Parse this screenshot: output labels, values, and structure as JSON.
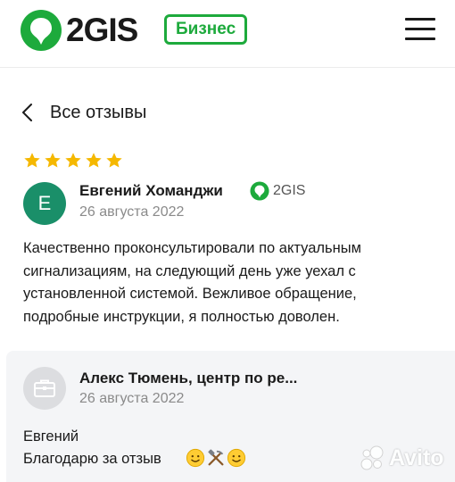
{
  "header": {
    "logo_text": "2GIS",
    "badge_label": "Бизнес",
    "brand_color": "#1daa3c",
    "menu_icon": "hamburger-menu-icon"
  },
  "nav": {
    "back_label": "Все отзывы",
    "back_icon": "chevron-left-icon"
  },
  "review": {
    "rating": 5,
    "rating_max": 5,
    "avatar_letter": "Е",
    "avatar_color": "#1a8f69",
    "author": "Евгений Хоманджи",
    "source_label": "2GIS",
    "date": "26 августа 2022",
    "text": "Качественно проконсультировали по актуальным сигнализациям, на следующий день уже уехал с установленной системой. Вежливое обращение, подробные инструкции, я полностью доволен."
  },
  "reply": {
    "avatar_icon": "briefcase-icon",
    "author": "Алекс Тюмень, центр по ре...",
    "date": "26 августа 2022",
    "line1": "Евгений",
    "line2": "Благодарю за отзыв",
    "emojis": [
      "slightly-smiling-face",
      "hammer-and-pick",
      "slightly-smiling-face"
    ],
    "background": "#f4f5f7"
  },
  "watermark": {
    "text": "Avito"
  }
}
